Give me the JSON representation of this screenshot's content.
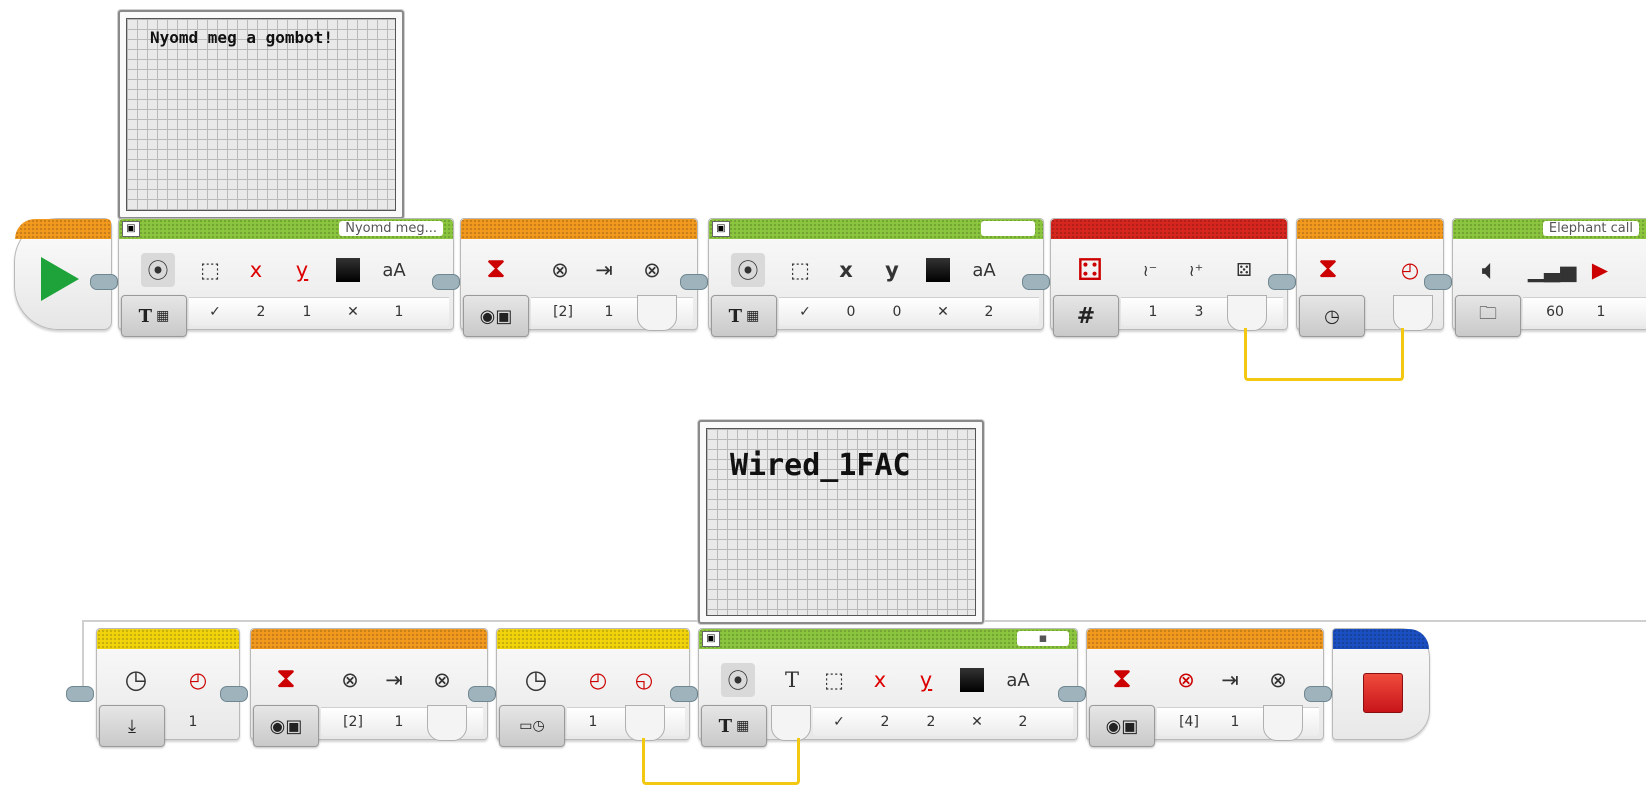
{
  "program": {
    "row1": {
      "display_preview_text": "Nyomd meg a gombot!",
      "display_block": {
        "label": "Nyomd meg...",
        "mode_icons": [
          "text-icon",
          "grid-icon"
        ],
        "params": [
          "✓",
          "2",
          "1",
          "✕",
          "1"
        ]
      },
      "wait_block_1": {
        "params": [
          "[2]",
          "1"
        ]
      },
      "display_block_2": {
        "label": "",
        "params": [
          "✓",
          "0",
          "0",
          "✕",
          "2"
        ]
      },
      "random_block": {
        "mode": "#",
        "params": [
          "1",
          "3"
        ]
      },
      "wait_timer_block": {},
      "sound_block": {
        "label": "Elephant call",
        "params": [
          "60",
          "1"
        ]
      }
    },
    "row2": {
      "display_preview_text": "Wired_1FAC",
      "timer_reset_block": {
        "params": [
          "1"
        ]
      },
      "wait_block_2": {
        "params": [
          "[2]",
          "1"
        ]
      },
      "timer_read_block": {
        "params": [
          "1"
        ]
      },
      "display_block_3": {
        "params": [
          "✓",
          "2",
          "2",
          "✕",
          "2"
        ]
      },
      "wait_block_3": {
        "params": [
          "[4]",
          "1"
        ]
      },
      "stop_block": {}
    }
  },
  "colors": {
    "action_green": "#8cc63f",
    "flow_orange": "#f39a1e",
    "math_red": "#d7261e",
    "sensor_yellow": "#f2d40c",
    "advanced_blue": "#1b4fc2",
    "wire_yellow": "#f2c811"
  }
}
